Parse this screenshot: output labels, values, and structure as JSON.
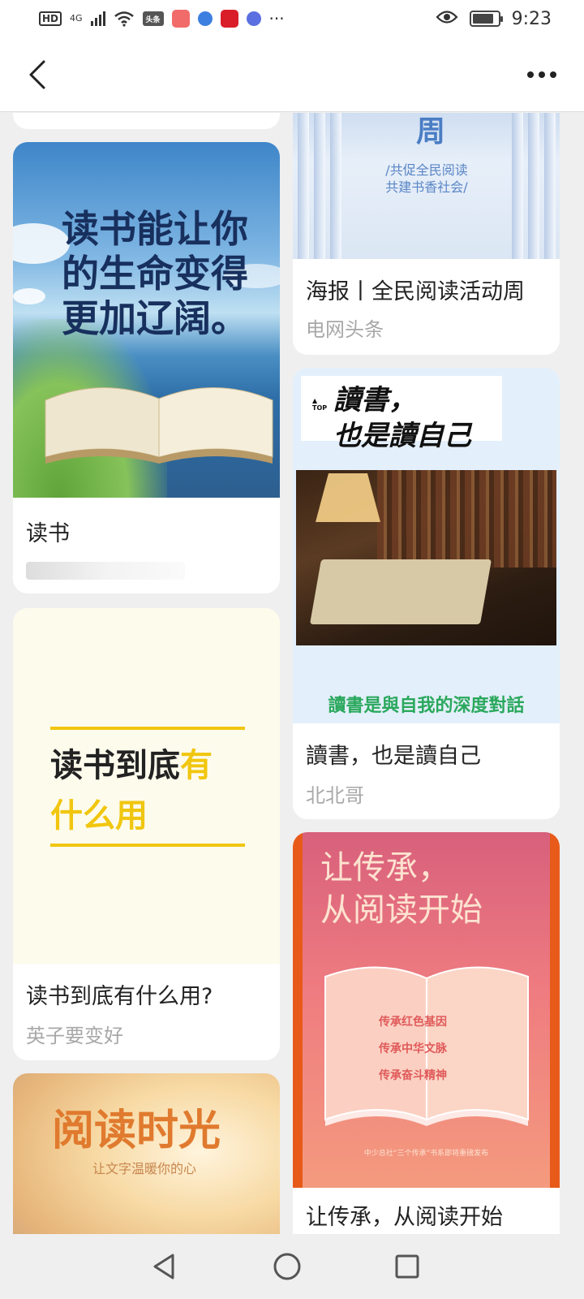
{
  "status_bar": {
    "network_badge": "HD",
    "network_type": "4G",
    "app_badge_news": "头条",
    "battery_level": 0.85,
    "time": "9:23",
    "overflow": "···"
  },
  "nav": {
    "back_icon": "chevron-left-icon",
    "more_icon": "more-horizontal-icon"
  },
  "feed": {
    "left": [
      {
        "title": "读书",
        "author": "",
        "poster_text": "读书能让你的生命变得更加辽阔。"
      },
      {
        "title": "读书到底有什么用?",
        "author": "英子要变好",
        "poster_text_a": "读书到底",
        "poster_text_b": "有",
        "poster_text_c": "什么用"
      },
      {
        "poster_text": "阅读时光",
        "poster_sub": "让文字温暖你的心"
      }
    ],
    "right": [
      {
        "title": "海报丨全民阅读活动周",
        "author": "电网头条",
        "poster_big": "周",
        "poster_small_1": "/共促全民阅读",
        "poster_small_2": "共建书香社会/"
      },
      {
        "title": "讀書，也是讀自己",
        "author": "北北哥",
        "top_tag": "TOP",
        "headline_1": "讀書，",
        "headline_2": "也是讀自己",
        "tagline": "讀書是與自我的深度對話"
      },
      {
        "title": "让传承，从阅读开始",
        "poster_text_1": "让传承，",
        "poster_text_2": "从阅读开始",
        "line_1": "传承红色基因",
        "line_2": "传承中华文脉",
        "line_3": "传承奋斗精神",
        "foot": "中少总社“三个传承”书系即将重磅发布"
      }
    ]
  },
  "bottom_nav": {
    "back": "triangle-back-icon",
    "home": "circle-home-icon",
    "recents": "square-recents-icon"
  },
  "colors": {
    "accent_yellow": "#f1c60f",
    "text_primary": "#222222",
    "text_secondary": "#a8a8a8",
    "tagline_green": "#2aa85c"
  }
}
